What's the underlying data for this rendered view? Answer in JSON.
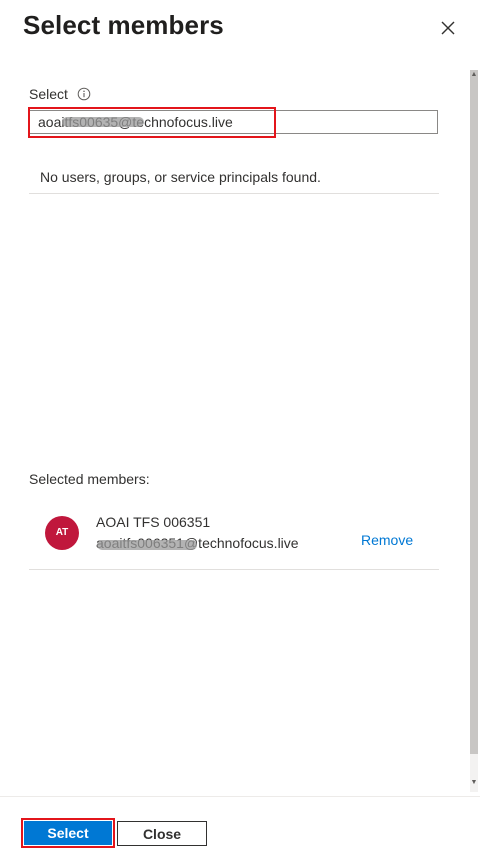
{
  "header": {
    "title": "Select members",
    "close_icon": "close-icon"
  },
  "search": {
    "label": "Select",
    "info_icon": "info-icon",
    "value": "aoaitfs00635@technofocus.live",
    "value_visible_prefix": "aoaitfs",
    "value_visible_suffix": "technofocus.live",
    "highlight_color": "#e3151b"
  },
  "results": {
    "empty_message": "No users, groups, or service principals found."
  },
  "selected": {
    "label": "Selected members:",
    "members": [
      {
        "initials": "AT",
        "name": "AOAI TFS 006351",
        "email": "aoaitfs006351@technofocus.live",
        "email_visible_suffix": "@technofocus.live",
        "remove_label": "Remove",
        "avatar_color": "#c0173c"
      }
    ]
  },
  "footer": {
    "select_label": "Select",
    "close_label": "Close",
    "accent_color": "#0078d4"
  }
}
